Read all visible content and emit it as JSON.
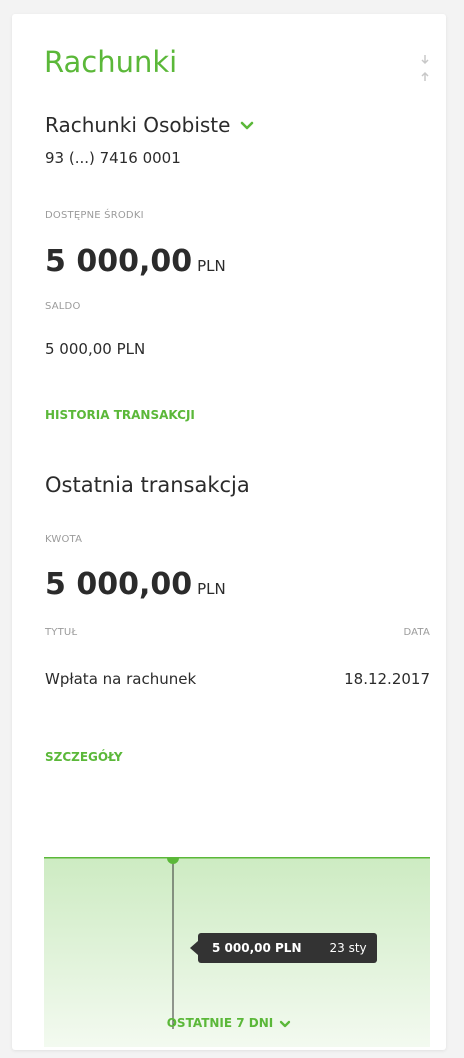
{
  "widget": {
    "title": "Rachunki",
    "account_name": "Rachunki Osobiste",
    "account_number": "93 (...) 7416 0001",
    "available_label": "DOSTĘPNE ŚRODKI",
    "available_amount": "5 000,00",
    "available_currency": "PLN",
    "balance_label": "SALDO",
    "balance_value": "5 000,00 PLN",
    "history_link": "HISTORIA TRANSAKCJI"
  },
  "last_transaction": {
    "title": "Ostatnia transakcja",
    "amount_label": "KWOTA",
    "amount": "5 000,00",
    "currency": "PLN",
    "title_label": "TYTUŁ",
    "date_label": "DATA",
    "title_value": "Wpłata na rachunek",
    "date_value": "18.12.2017",
    "details_link": "SZCZEGÓŁY"
  },
  "chart": {
    "tooltip_amount": "5 000,00 PLN",
    "tooltip_date": "23 sty",
    "period_label": "OSTATNIE 7 DNI"
  },
  "colors": {
    "accent": "#5bb839",
    "tooltip_bg": "#333333"
  },
  "icons": [
    "drag-handle-icon",
    "chevron-down-icon"
  ]
}
